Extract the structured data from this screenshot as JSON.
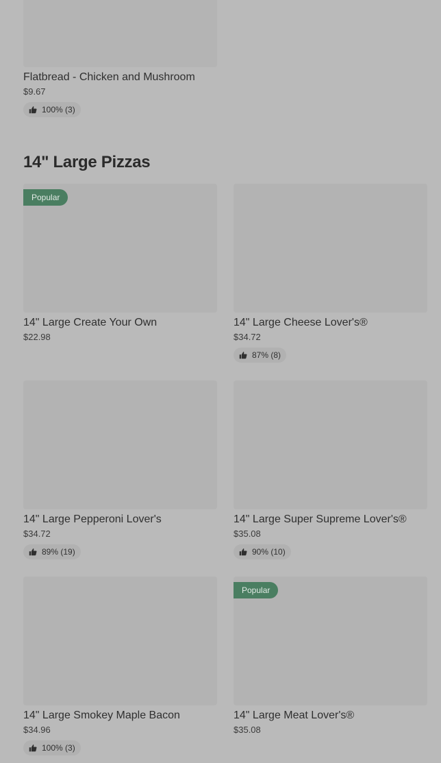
{
  "top_item": {
    "name": "Flatbread - Chicken and Mushroom",
    "price": "$9.67",
    "rating": "100% (3)"
  },
  "section": {
    "title": "14\" Large Pizzas"
  },
  "items": [
    {
      "name": "14\" Large Create Your Own",
      "price": "$22.98",
      "rating": "",
      "badge": "Popular"
    },
    {
      "name": "14\" Large Cheese Lover's®",
      "price": "$34.72",
      "rating": "87% (8)",
      "badge": ""
    },
    {
      "name": "14\" Large Pepperoni Lover's",
      "price": "$34.72",
      "rating": "89% (19)",
      "badge": ""
    },
    {
      "name": "14\" Large Super Supreme Lover's®",
      "price": "$35.08",
      "rating": "90% (10)",
      "badge": ""
    },
    {
      "name": "14\" Large Smokey Maple Bacon",
      "price": "$34.96",
      "rating": "100% (3)",
      "badge": ""
    },
    {
      "name": "14\" Large Meat Lover's®",
      "price": "$35.08",
      "rating": "",
      "badge": "Popular"
    }
  ],
  "icons": {
    "rating_icon": "thumbs-up-icon"
  },
  "colors": {
    "background": "#bababa",
    "thumbnail": "#b3b3b3",
    "badge": "#4a7e61",
    "rating_pill": "#b1b1b1"
  }
}
